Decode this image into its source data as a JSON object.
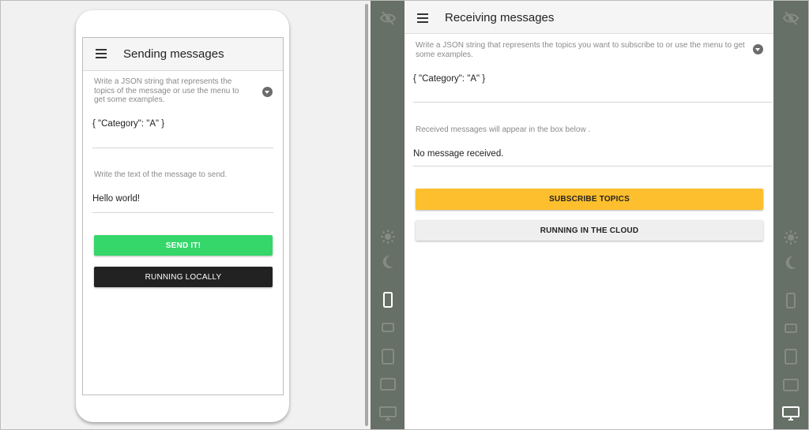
{
  "sending": {
    "title": "Sending messages",
    "topics_hint": "Write a JSON string that represents the topics of the message or use the menu to get some examples.",
    "topics_value": "{ \"Category\": \"A\" }",
    "message_hint": "Write the text of the message to send.",
    "message_value": "Hello world!",
    "send_label": "SEND IT!",
    "running_label": "RUNNING LOCALLY"
  },
  "receiving": {
    "title": "Receiving messages",
    "topics_hint": "Write a JSON string that represents the topics you want to subscribe to or use the menu to get some examples.",
    "topics_value": "{ \"Category\": \"A\" }",
    "received_hint": "Received messages will appear in the box below .",
    "received_value": "No message received.",
    "subscribe_label": "SUBSCRIBE TOPICS",
    "running_label": "RUNNING IN THE CLOUD"
  },
  "colors": {
    "send": "#35d66a",
    "running_local": "#222222",
    "subscribe": "#fdbf2d",
    "running_cloud": "#efefef",
    "sidebar": "#667066",
    "sidebar_icon": "#848c84"
  },
  "sidebar_icons": [
    "eye-off-icon",
    "sun-icon",
    "moon-icon",
    "phone-portrait-icon",
    "phone-landscape-icon",
    "tablet-portrait-icon",
    "tablet-landscape-icon",
    "desktop-icon"
  ]
}
